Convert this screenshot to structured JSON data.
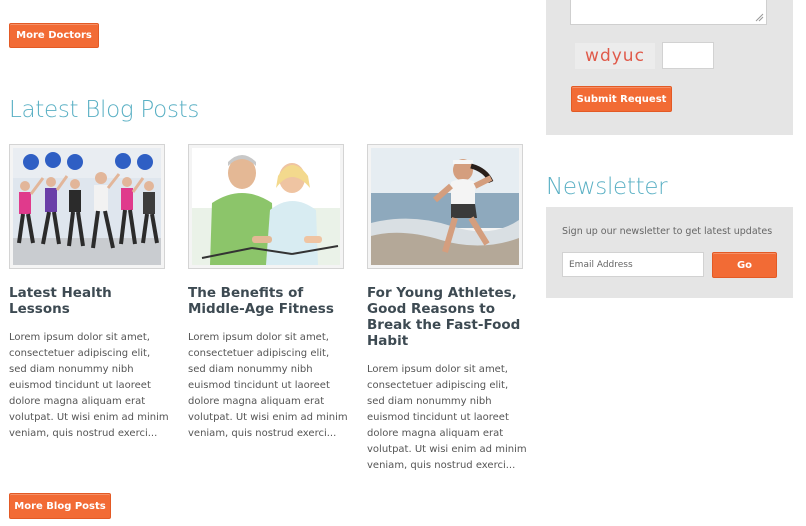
{
  "buttons": {
    "more_doctors": "More Doctors",
    "more_blog_posts": "More Blog Posts",
    "submit_request": "Submit Request",
    "go": "Go"
  },
  "blog": {
    "section_title": "Latest Blog Posts",
    "posts": [
      {
        "title": "Latest Health Lessons",
        "excerpt": "Lorem ipsum dolor sit amet, consectetuer adipiscing elit, sed diam nonummy nibh euismod tincidunt ut laoreet dolore magna aliquam erat volutpat. Ut wisi enim ad minim veniam, quis nostrud exerci...",
        "image": "fitness-class-photo"
      },
      {
        "title": "The Benefits of Middle-Age Fitness",
        "excerpt": "Lorem ipsum dolor sit amet, consectetuer adipiscing elit, sed diam nonummy nibh euismod tincidunt ut laoreet dolore magna aliquam erat volutpat. Ut wisi enim ad minim veniam, quis nostrud exerci...",
        "image": "couple-cycling-photo"
      },
      {
        "title": "For Young Athletes, Good Reasons to Break the Fast-Food Habit",
        "excerpt": "Lorem ipsum dolor sit amet, consectetuer adipiscing elit, sed diam nonummy nibh euismod tincidunt ut laoreet dolore magna aliquam erat volutpat. Ut wisi enim ad minim veniam, quis nostrud exerci...",
        "image": "beach-runner-photo"
      }
    ]
  },
  "request_form": {
    "captcha_text": "wdyuc"
  },
  "newsletter": {
    "title": "Newsletter",
    "description": "Sign up our newsletter to get latest updates",
    "email_placeholder": "Email Address"
  },
  "colors": {
    "accent": "#f26b35",
    "heading": "#5ab0c4",
    "panel": "#e5e5e5"
  }
}
